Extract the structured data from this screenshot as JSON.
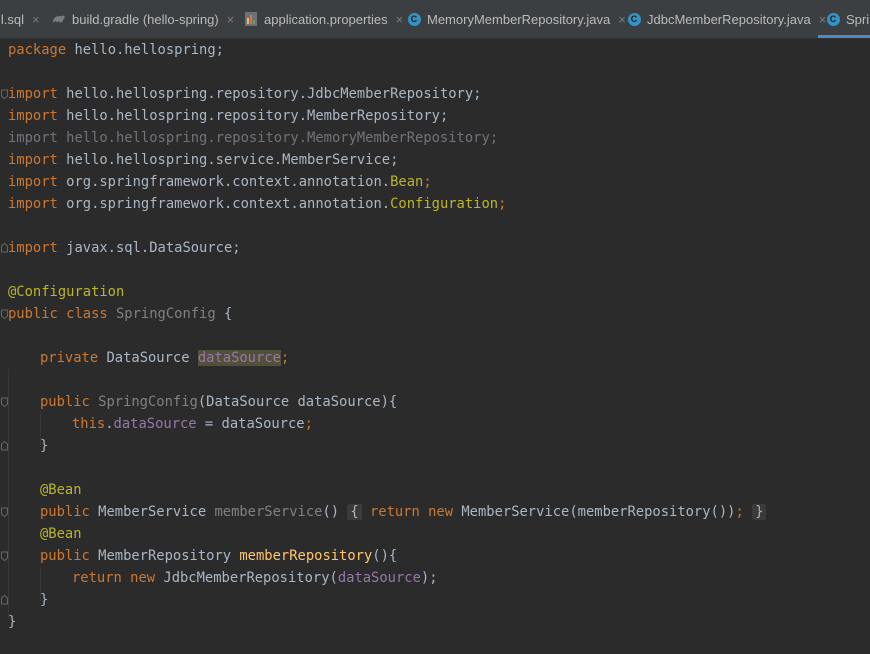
{
  "tabs": [
    {
      "label": "ll.sql",
      "icon": "sql-file-icon"
    },
    {
      "label": "build.gradle (hello-spring)",
      "icon": "gradle-icon"
    },
    {
      "label": "application.properties",
      "icon": "properties-file-icon"
    },
    {
      "label": "MemoryMemberRepository.java",
      "icon": "java-class-icon"
    },
    {
      "label": "JdbcMemberRepository.java",
      "icon": "java-class-icon"
    },
    {
      "label": "Sprin",
      "icon": "java-class-icon",
      "active": true
    }
  ],
  "close_glyph": "×",
  "class_icon_letter": "C",
  "code": {
    "l1": {
      "kw": "package",
      "rest": " hello.hellospring;"
    },
    "l3": {
      "kw": "import",
      "rest": " hello.hellospring.repository.JdbcMemberRepository;"
    },
    "l4": {
      "kw": "import",
      "rest": " hello.hellospring.repository.MemberRepository;"
    },
    "l5": {
      "text": "import hello.hellospring.repository.MemoryMemberRepository;"
    },
    "l6": {
      "kw": "import",
      "rest": " hello.hellospring.service.MemberService;"
    },
    "l7": {
      "kw": "import",
      "pre": " org.springframework.context.annotation.",
      "cls": "Bean",
      "semi": ";"
    },
    "l8": {
      "kw": "import",
      "pre": " org.springframework.context.annotation.",
      "cls": "Configuration",
      "semi": ";"
    },
    "l10": {
      "kw": "import",
      "rest": " javax.sql.DataSource;"
    },
    "l12": {
      "ann": "@Configuration"
    },
    "l13": {
      "kw": "public class",
      "name": " SpringConfig",
      "rest": " {"
    },
    "l15": {
      "kw": "private",
      "type": " DataSource ",
      "field": "dataSource",
      "semi": ";"
    },
    "l17": {
      "kw": "public",
      "name": " SpringConfig",
      "rest": "(DataSource dataSource){"
    },
    "l18": {
      "kw": "this",
      "dot": ".",
      "field": "dataSource",
      "rest": " = dataSource",
      "semi": ";"
    },
    "l19": {
      "text": "}"
    },
    "l21": {
      "ann": "@Bean"
    },
    "l22": {
      "kw": "public",
      "type": " MemberService ",
      "name": "memberService",
      "paren": "() ",
      "open": "{",
      "kw2": " return new",
      "rest": " MemberService(memberRepository())",
      "semi": ";",
      "close": "}"
    },
    "l23": {
      "ann": "@Bean"
    },
    "l24": {
      "kw": "public",
      "type": " MemberRepository ",
      "fn": "memberRepository",
      "rest": "(){"
    },
    "l25": {
      "kw": "return new",
      "rest": " JdbcMemberRepository(",
      "field": "dataSource",
      "end": ");"
    },
    "l26": {
      "text": "}"
    },
    "l27": {
      "text": "}"
    }
  }
}
